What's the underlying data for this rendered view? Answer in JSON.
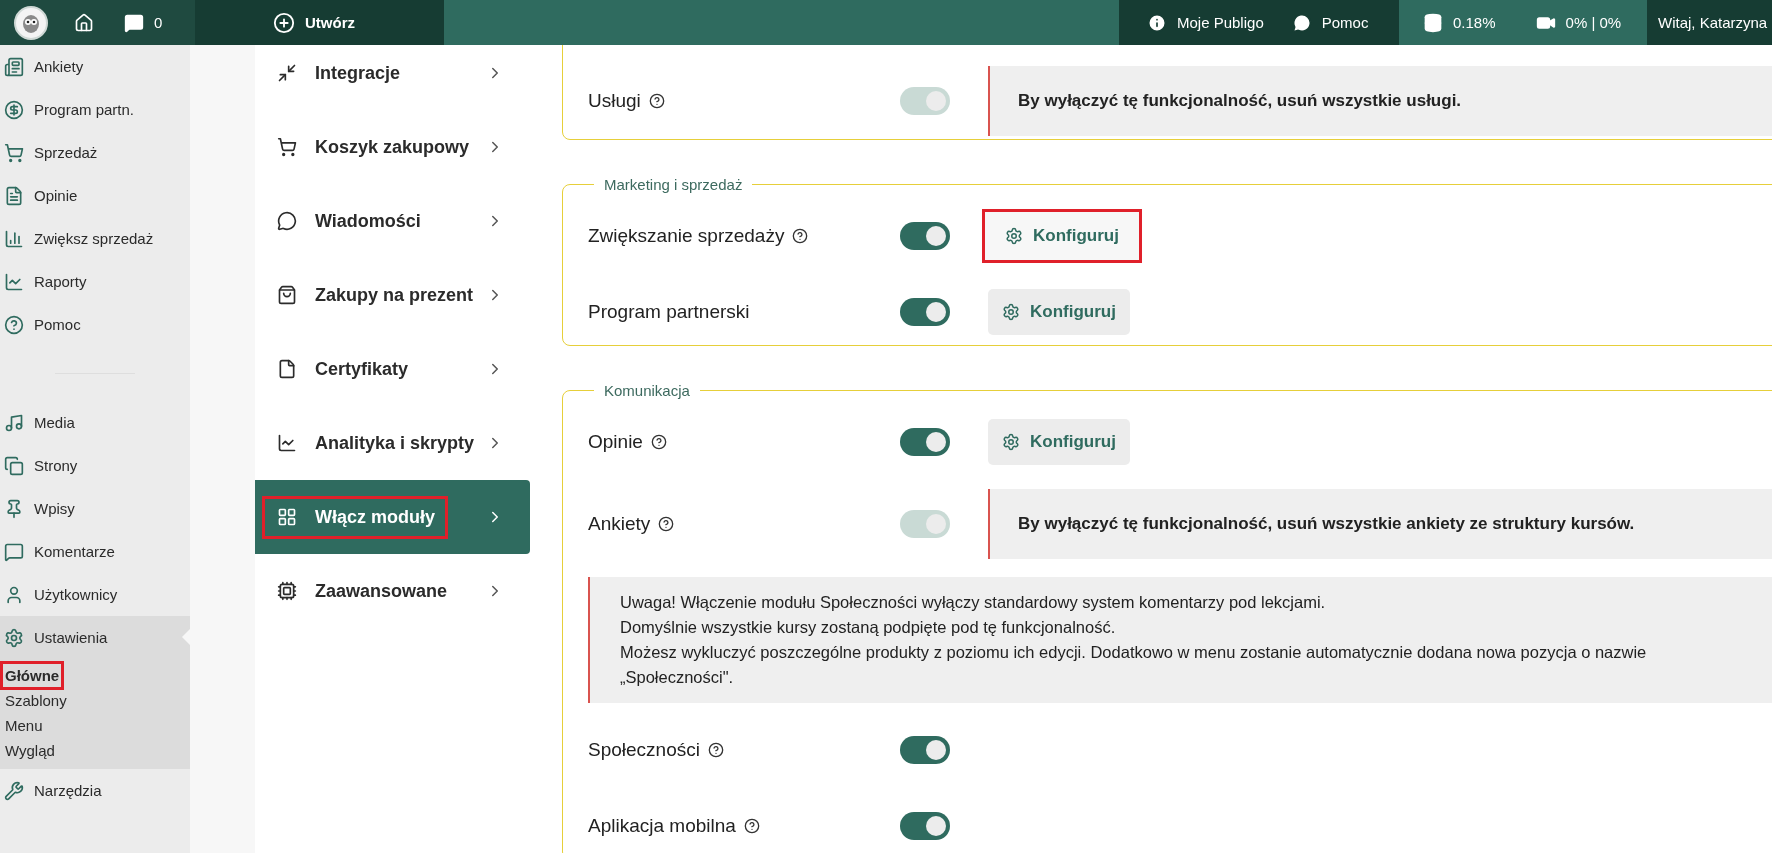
{
  "topbar": {
    "comment_count": "0",
    "create": "Utwórz",
    "links": [
      "Moje Publigo",
      "Pomoc"
    ],
    "storage": "0.18%",
    "video": "0% | 0%",
    "greeting": "Witaj, Katarzyna"
  },
  "sidebar": {
    "groups": [
      [
        {
          "label": "Ankiety",
          "selected": false
        },
        {
          "label": "Program partn.",
          "selected": false
        },
        {
          "label": "Sprzedaż",
          "selected": false
        },
        {
          "label": "Opinie",
          "selected": false
        },
        {
          "label": "Zwiększ sprzedaż",
          "selected": false
        },
        {
          "label": "Raporty",
          "selected": false
        },
        {
          "label": "Pomoc",
          "selected": false
        }
      ],
      [
        {
          "label": "Media",
          "selected": false
        },
        {
          "label": "Strony",
          "selected": false
        },
        {
          "label": "Wpisy",
          "selected": false
        },
        {
          "label": "Komentarze",
          "selected": false
        },
        {
          "label": "Użytkownicy",
          "selected": false
        },
        {
          "label": "Ustawienia",
          "selected": true,
          "expanded": true,
          "children": [
            {
              "label": "Główne",
              "selected": true,
              "highlighted": true
            },
            {
              "label": "Szablony",
              "selected": false,
              "highlighted": false
            },
            {
              "label": "Menu",
              "selected": false,
              "highlighted": false
            },
            {
              "label": "Wygląd",
              "selected": false,
              "highlighted": false
            }
          ]
        },
        {
          "label": "Narzędzia",
          "selected": false
        }
      ]
    ]
  },
  "settings_menu": [
    {
      "label": "Integracje",
      "selected": false,
      "highlighted": false
    },
    {
      "label": "Koszyk zakupowy",
      "selected": false,
      "highlighted": false
    },
    {
      "label": "Wiadomości",
      "selected": false,
      "highlighted": false
    },
    {
      "label": "Zakupy na prezent",
      "selected": false,
      "highlighted": false
    },
    {
      "label": "Certyfikaty",
      "selected": false,
      "highlighted": false
    },
    {
      "label": "Analityka i skrypty",
      "selected": false,
      "highlighted": false
    },
    {
      "label": "Włącz moduły",
      "selected": true,
      "highlighted": true
    },
    {
      "label": "Zaawansowane",
      "selected": false,
      "highlighted": false
    }
  ],
  "sections": [
    {
      "rows": [
        {
          "kind": "toggle",
          "label": "Usługi",
          "help": true,
          "on": true,
          "disabled": true,
          "notice": "By wyłączyć tę funkcjonalność, usuń wszystkie usługi."
        }
      ]
    },
    {
      "legend": "Marketing i sprzedaż",
      "rows": [
        {
          "kind": "toggle",
          "label": "Zwiększanie sprzedaży",
          "help": true,
          "on": true,
          "disabled": false,
          "action": {
            "label": "Konfiguruj",
            "highlighted": true
          }
        },
        {
          "kind": "toggle",
          "label": "Program partnerski",
          "help": false,
          "on": true,
          "disabled": false,
          "action": {
            "label": "Konfiguruj",
            "highlighted": false
          }
        }
      ]
    },
    {
      "legend": "Komunikacja",
      "rows": [
        {
          "kind": "toggle",
          "label": "Opinie",
          "help": true,
          "on": true,
          "disabled": false,
          "action": {
            "label": "Konfiguruj",
            "highlighted": false
          }
        },
        {
          "kind": "toggle",
          "label": "Ankiety",
          "help": true,
          "on": true,
          "disabled": true,
          "notice": "By wyłączyć tę funkcjonalność, usuń wszystkie ankiety ze struktury kursów."
        },
        {
          "kind": "warning",
          "lines": [
            "Uwaga! Włączenie modułu Społeczności wyłączy standardowy system komentarzy pod lekcjami.",
            "Domyślnie wszystkie kursy zostaną podpięte pod tę funkcjonalność.",
            "Możesz wykluczyć poszczególne produkty z poziomu ich edycji. Dodatkowo w menu zostanie automatycznie dodana nowa pozycja o nazwie „Społeczności\"."
          ]
        },
        {
          "kind": "toggle",
          "label": "Społeczności",
          "help": true,
          "on": true,
          "disabled": false
        },
        {
          "kind": "toggle",
          "label": "Aplikacja mobilna",
          "help": true,
          "on": true,
          "disabled": false
        }
      ]
    }
  ]
}
